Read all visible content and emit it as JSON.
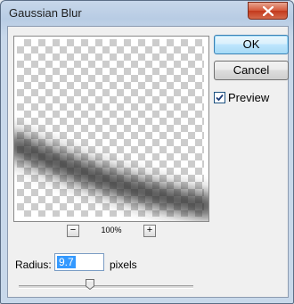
{
  "window": {
    "title": "Gaussian Blur"
  },
  "buttons": {
    "ok": "OK",
    "cancel": "Cancel"
  },
  "preview": {
    "label": "Preview",
    "checked": true
  },
  "zoom": {
    "out": "−",
    "in": "+",
    "level": "100%"
  },
  "radius": {
    "label": "Radius:",
    "value": "9.7",
    "unit": "pixels"
  },
  "slider": {
    "fraction": 0.41
  },
  "icons": {
    "close": "close-icon",
    "checkmark": "checkmark-icon",
    "thumb": "slider-thumb-icon"
  }
}
